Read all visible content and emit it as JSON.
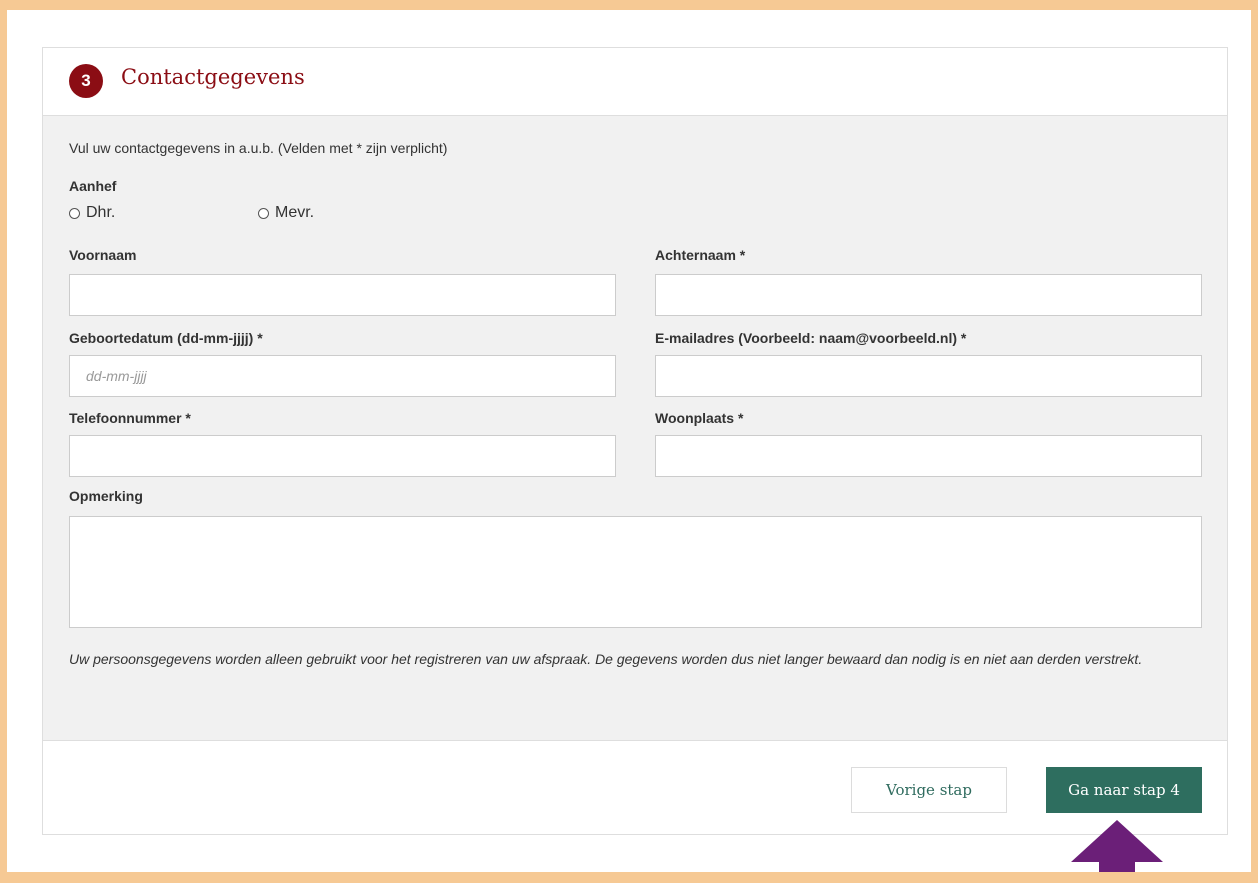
{
  "header": {
    "step_number": "3",
    "title": "Contactgegevens"
  },
  "intro": "Vul uw contactgegevens in a.u.b. (Velden met * zijn verplicht)",
  "salutation": {
    "label": "Aanhef",
    "options": [
      "Dhr.",
      "Mevr."
    ]
  },
  "fields": {
    "firstname": {
      "label": "Voornaam",
      "value": ""
    },
    "lastname": {
      "label": "Achternaam *",
      "value": ""
    },
    "birthdate": {
      "label": "Geboortedatum (dd-mm-jjjj) *",
      "placeholder": "dd-mm-jjjj",
      "value": ""
    },
    "email": {
      "label": "E-mailadres (Voorbeeld: naam@voorbeeld.nl) *",
      "value": ""
    },
    "phone": {
      "label": "Telefoonnummer *",
      "value": ""
    },
    "city": {
      "label": "Woonplaats *",
      "value": ""
    },
    "remark": {
      "label": "Opmerking",
      "value": ""
    }
  },
  "privacy_note": "Uw persoonsgegevens worden alleen gebruikt voor het registreren van uw afspraak. De gegevens worden dus niet langer bewaard dan nodig is en niet aan derden verstrekt.",
  "buttons": {
    "previous": "Vorige stap",
    "next": "Ga naar stap 4"
  },
  "colors": {
    "accent": "#8b0d14",
    "primary_button": "#2e6e5f",
    "frame": "#f6c994",
    "annotation_arrow": "#6b1f78"
  }
}
